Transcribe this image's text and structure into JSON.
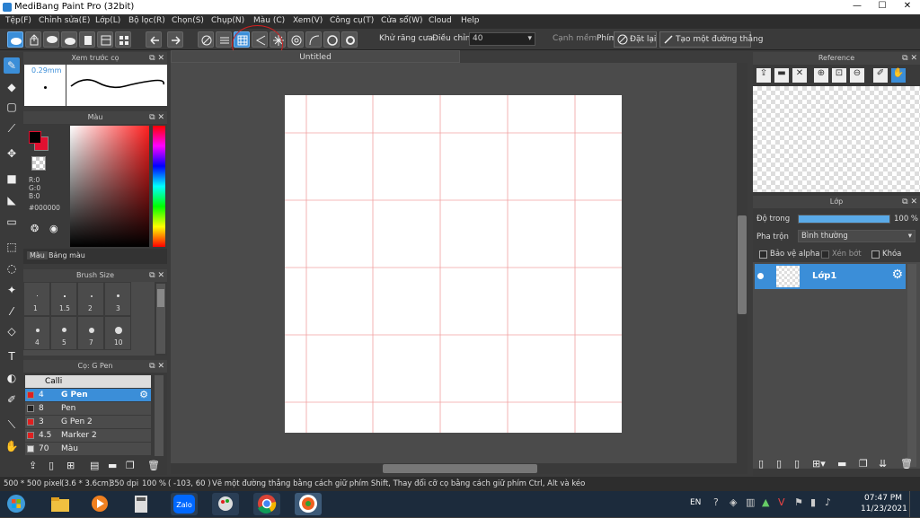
{
  "window": {
    "title": "MediBang Paint Pro (32bit)",
    "minimize": "—",
    "maximize": "☐",
    "close": "✕"
  },
  "menu": [
    "Tệp(F)",
    "Chỉnh sửa(E)",
    "Lớp(L)",
    "Bộ lọc(R)",
    "Chọn(S)",
    "Chụp(N)",
    "Màu (C)",
    "Xem(V)",
    "Công cụ(T)",
    "Cửa sổ(W)",
    "Cloud",
    "Help"
  ],
  "toolbar": {
    "antialias_label": "Khử răng cưa",
    "correction_label": "Điều chỉnh",
    "correction_value": "40",
    "edge_label": "Cạnh mềm",
    "key_label": "Phím",
    "reset_label": "Đặt lại",
    "line_label": "Tạo một đường thẳng"
  },
  "document": {
    "tab_title": "Untitled",
    "grid_cols": 5,
    "grid_rows": 5,
    "grid_color": "#f0a0a0"
  },
  "preview_panel": {
    "title": "Xem trước cọ",
    "size": "0.29mm"
  },
  "color_panel": {
    "title": "Màu",
    "r": "R:0",
    "g": "G:0",
    "b": "B:0",
    "hex": "#000000",
    "tab1": "Màu",
    "tab2": "Bảng màu",
    "fg_color": "#000000",
    "bg_color": "#e01030"
  },
  "brush_size_panel": {
    "title": "Brush Size",
    "sizes": [
      "1",
      "1.5",
      "2",
      "3",
      "4",
      "5",
      "7",
      "10"
    ]
  },
  "brush_panel": {
    "title": "Cọ: G Pen",
    "group": "Calli",
    "items": [
      {
        "size": "4",
        "name": "G Pen",
        "color": "#e02020",
        "selected": true
      },
      {
        "size": "8",
        "name": "Pen",
        "color": "#222222",
        "selected": false
      },
      {
        "size": "3",
        "name": "G Pen 2",
        "color": "#e02020",
        "selected": false
      },
      {
        "size": "4.5",
        "name": "Marker 2",
        "color": "#e02020",
        "selected": false
      },
      {
        "size": "70",
        "name": "Màu",
        "color": "#dddddd",
        "selected": false
      }
    ]
  },
  "reference_panel": {
    "title": "Reference"
  },
  "layer_panel": {
    "title": "Lớp",
    "opacity_label": "Độ trong",
    "opacity_value": "100 %",
    "opacity": 1.0,
    "blend_label": "Pha trộn",
    "blend_value": "Bình thường",
    "protect_alpha": "Bảo vệ alpha",
    "clipping": "Xén bớt",
    "lock": "Khóa",
    "layer_name": "Lớp1"
  },
  "status": {
    "size": "500 * 500 pixel",
    "cm": "(3.6 * 3.6cm)",
    "dpi": "350 dpi",
    "zoom": "100 %",
    "coords": "( -103, 60 )",
    "hint": "Vẽ một đường thẳng bằng cách giữ phím Shift, Thay đổi cỡ cọ bằng cách giữ phím Ctrl, Alt và kéo"
  },
  "taskbar": {
    "lang": "EN",
    "time": "07:47 PM",
    "date": "11/23/2021",
    "zalo": "Zalo"
  }
}
